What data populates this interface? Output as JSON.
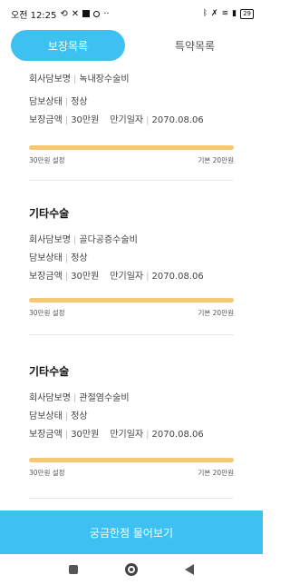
{
  "status_bar": {
    "time": "오전 12:25",
    "icons_left": [
      "sync-icon",
      "x-icon",
      "square-icon",
      "ring-icon",
      "more-dots-icon"
    ],
    "more": "··",
    "icons_right": [
      "bluetooth-icon",
      "mute-icon",
      "wifi-icon",
      "signal-icon"
    ],
    "battery": "29"
  },
  "tabs": [
    {
      "label": "보장목록",
      "active": true
    },
    {
      "label": "특약목록",
      "active": false
    }
  ],
  "cards": [
    {
      "title": "",
      "company_label": "회사담보명",
      "company_value": "녹내장수술비",
      "status_label": "담보상태",
      "status_value": "정상",
      "amount_label": "보장금액",
      "amount_value": "30만원",
      "expiry_label": "만기일자",
      "expiry_value": "2070.08.06",
      "bar_left": "30만원 설정",
      "bar_right": "기본 20만원",
      "progress": 1.0
    },
    {
      "title": "기타수술",
      "company_label": "회사담보명",
      "company_value": "골다공증수술비",
      "status_label": "담보상태",
      "status_value": "정상",
      "amount_label": "보장금액",
      "amount_value": "30만원",
      "expiry_label": "만기일자",
      "expiry_value": "2070.08.06",
      "bar_left": "30만원 설정",
      "bar_right": "기본 20만원",
      "progress": 1.0
    },
    {
      "title": "기타수술",
      "company_label": "회사담보명",
      "company_value": "관절염수술비",
      "status_label": "담보상태",
      "status_value": "정상",
      "amount_label": "보장금액",
      "amount_value": "30만원",
      "expiry_label": "만기일자",
      "expiry_value": "2070.08.06",
      "bar_left": "30만원 설정",
      "bar_right": "기본 20만원",
      "progress": 1.0
    }
  ],
  "cta": {
    "label": "궁금한점 물어보기"
  },
  "colors": {
    "accent": "#3ec1f1",
    "bar": "#f7c873"
  }
}
